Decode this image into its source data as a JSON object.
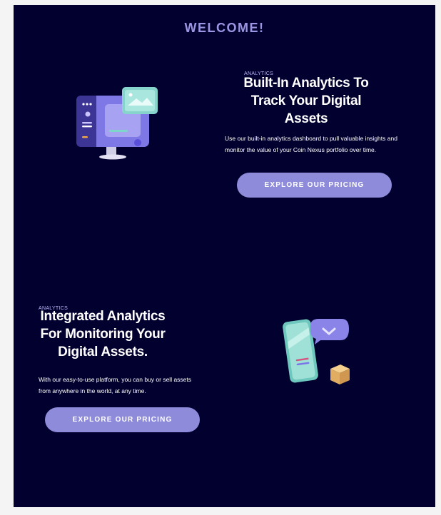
{
  "page": {
    "welcome": "WELCOME!"
  },
  "section1": {
    "eyebrow": "ANALYTICS",
    "heading_lines": [
      "Built-In Analytics To",
      "Track Your Digital",
      "Assets"
    ],
    "description_lines": [
      "Use our built-in analytics dashboard to pull valuable insights and",
      "monitor the value of your Coin Nexus portfolio over time."
    ],
    "button_label": "EXPLORE OUR PRICING",
    "illustration_icon": "computer-dashboard-icon"
  },
  "section2": {
    "eyebrow": "ANALYTICS",
    "heading_lines": [
      "Integrated Analytics",
      "For Monitoring Your",
      "Digital Assets."
    ],
    "description_lines": [
      "With our easy-to-use platform, you can buy or sell assets",
      "from anywhere in the world, at any time."
    ],
    "button_label": "EXPLORE OUR PRICING",
    "illustration_icon": "phone-chat-box-icon"
  },
  "colors": {
    "background": "#02002e",
    "accent": "#8f8bdb",
    "heading": "#9b96e4"
  }
}
